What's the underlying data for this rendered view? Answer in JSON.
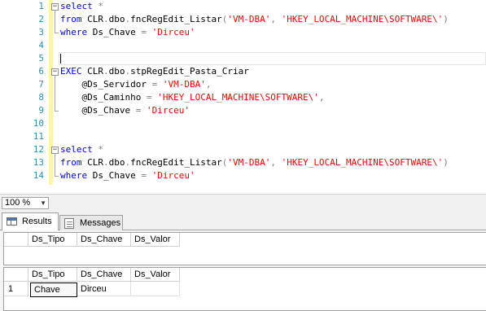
{
  "editor": {
    "line_numbers": [
      "1",
      "2",
      "3",
      "4",
      "5",
      "6",
      "7",
      "8",
      "9",
      "10",
      "11",
      "12",
      "13",
      "14"
    ],
    "lines": [
      [
        {
          "t": "select",
          "c": "kw"
        },
        {
          "t": " "
        },
        {
          "t": "*",
          "c": "op"
        }
      ],
      [
        {
          "t": "from",
          "c": "kw"
        },
        {
          "t": " CLR"
        },
        {
          "t": ".",
          "c": "op"
        },
        {
          "t": "dbo"
        },
        {
          "t": ".",
          "c": "op"
        },
        {
          "t": "fncRegEdit_Listar"
        },
        {
          "t": "(",
          "c": "op"
        },
        {
          "t": "'VM-DBA'",
          "c": "st"
        },
        {
          "t": ",",
          "c": "op"
        },
        {
          "t": " "
        },
        {
          "t": "'HKEY_LOCAL_MACHINE\\SOFTWARE\\'",
          "c": "st"
        },
        {
          "t": ")",
          "c": "op"
        }
      ],
      [
        {
          "t": "where",
          "c": "kw"
        },
        {
          "t": " Ds_Chave "
        },
        {
          "t": "=",
          "c": "op"
        },
        {
          "t": " "
        },
        {
          "t": "'Dirceu'",
          "c": "st"
        }
      ],
      [],
      [],
      [
        {
          "t": "EXEC",
          "c": "kw"
        },
        {
          "t": " CLR"
        },
        {
          "t": ".",
          "c": "op"
        },
        {
          "t": "dbo"
        },
        {
          "t": ".",
          "c": "op"
        },
        {
          "t": "stpRegEdit_Pasta_Criar"
        }
      ],
      [
        {
          "t": "    @Ds_Servidor "
        },
        {
          "t": "=",
          "c": "op"
        },
        {
          "t": " "
        },
        {
          "t": "'VM-DBA'",
          "c": "st"
        },
        {
          "t": ",",
          "c": "op"
        }
      ],
      [
        {
          "t": "    @Ds_Caminho "
        },
        {
          "t": "=",
          "c": "op"
        },
        {
          "t": " "
        },
        {
          "t": "'HKEY_LOCAL_MACHINE\\SOFTWARE\\'",
          "c": "st"
        },
        {
          "t": ",",
          "c": "op"
        }
      ],
      [
        {
          "t": "    @Ds_Chave "
        },
        {
          "t": "=",
          "c": "op"
        },
        {
          "t": " "
        },
        {
          "t": "'Dirceu'",
          "c": "st"
        }
      ],
      [],
      [],
      [
        {
          "t": "select",
          "c": "kw"
        },
        {
          "t": " "
        },
        {
          "t": "*",
          "c": "op"
        }
      ],
      [
        {
          "t": "from",
          "c": "kw"
        },
        {
          "t": " CLR"
        },
        {
          "t": ".",
          "c": "op"
        },
        {
          "t": "dbo"
        },
        {
          "t": ".",
          "c": "op"
        },
        {
          "t": "fncRegEdit_Listar"
        },
        {
          "t": "(",
          "c": "op"
        },
        {
          "t": "'VM-DBA'",
          "c": "st"
        },
        {
          "t": ",",
          "c": "op"
        },
        {
          "t": " "
        },
        {
          "t": "'HKEY_LOCAL_MACHINE\\SOFTWARE\\'",
          "c": "st"
        },
        {
          "t": ")",
          "c": "op"
        }
      ],
      [
        {
          "t": "where",
          "c": "kw"
        },
        {
          "t": " Ds_Chave "
        },
        {
          "t": "=",
          "c": "op"
        },
        {
          "t": " "
        },
        {
          "t": "'Dirceu'",
          "c": "st"
        }
      ]
    ],
    "colors": {
      "keyword": "#0000ff",
      "string": "#ff0000",
      "operator": "#808080",
      "line_number": "#2b91af"
    }
  },
  "zoom": {
    "value": "100 %"
  },
  "tabs": [
    {
      "label": "Results",
      "icon": "grid-icon",
      "active": true
    },
    {
      "label": "Messages",
      "icon": "messages-icon",
      "active": false
    }
  ],
  "grid1": {
    "columns": [
      "Ds_Tipo",
      "Ds_Chave",
      "Ds_Valor"
    ],
    "rows": []
  },
  "grid2": {
    "columns": [
      "Ds_Tipo",
      "Ds_Chave",
      "Ds_Valor"
    ],
    "rows": [
      {
        "num": "1",
        "cells": [
          "Chave",
          "Dirceu",
          ""
        ]
      }
    ]
  }
}
